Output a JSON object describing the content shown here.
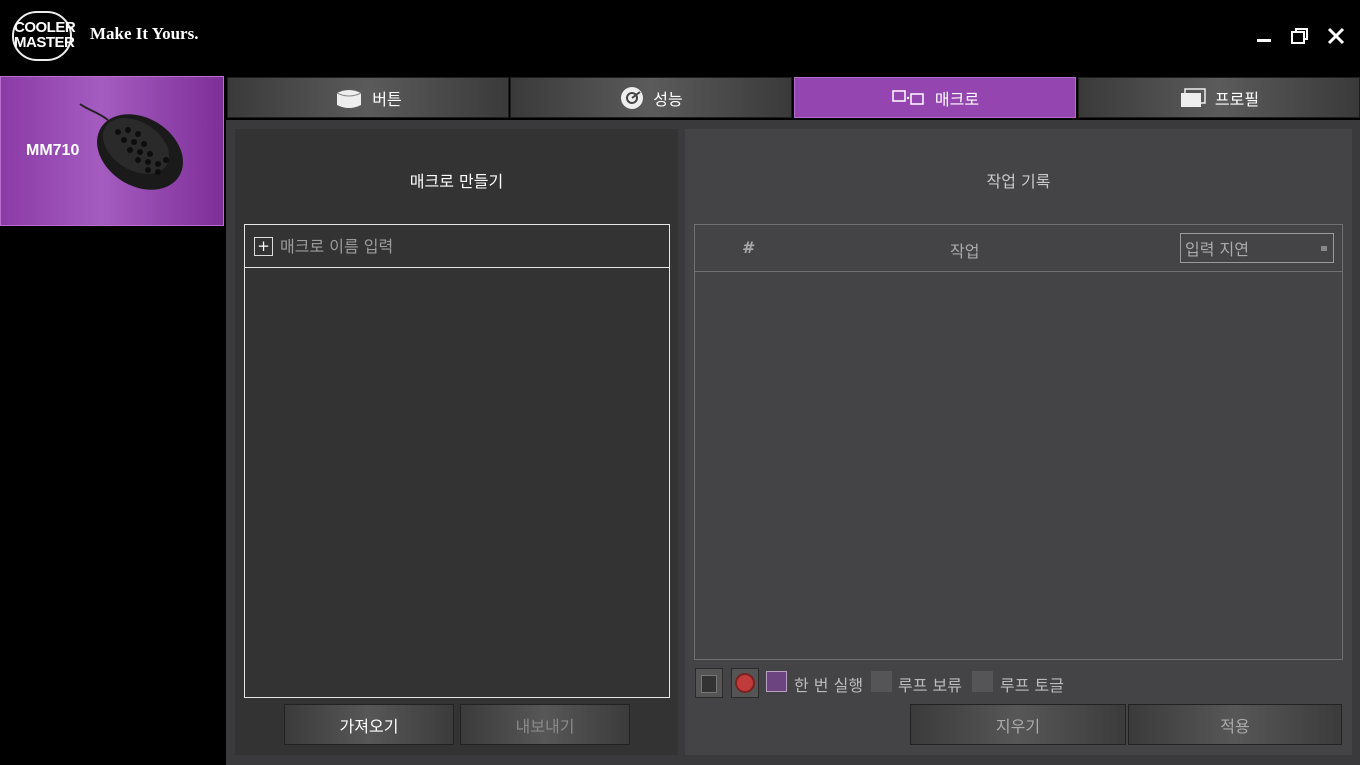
{
  "header": {
    "logo_lines": [
      "COOLER",
      "MASTER"
    ],
    "tagline": "Make It Yours.",
    "window_controls": [
      "minimize-icon",
      "maximize-icon",
      "close-icon"
    ]
  },
  "device": {
    "name": "MM710"
  },
  "tabs": [
    {
      "label": "버튼",
      "icon": "button-icon",
      "active": false
    },
    {
      "label": "성능",
      "icon": "performance-icon",
      "active": false
    },
    {
      "label": "매크로",
      "icon": "macro-icon",
      "active": true
    },
    {
      "label": "프로필",
      "icon": "profile-icon",
      "active": false
    }
  ],
  "macro_panel": {
    "title": "매크로 만들기",
    "add_label": "+",
    "name_placeholder": "매크로 이름 입력",
    "import_label": "가져오기",
    "export_label": "내보내기"
  },
  "record_panel": {
    "title": "작업 기록",
    "col_num": "#",
    "col_action": "작업",
    "delay_option": "입력 지연",
    "options": [
      {
        "label": "한 번 실행",
        "checked": true
      },
      {
        "label": "루프 보류",
        "checked": false
      },
      {
        "label": "루프 토글",
        "checked": false
      }
    ],
    "clear_label": "지우기",
    "apply_label": "적용"
  },
  "colors": {
    "accent": "#9445b0",
    "background": "#000000",
    "panel": "#333334"
  }
}
